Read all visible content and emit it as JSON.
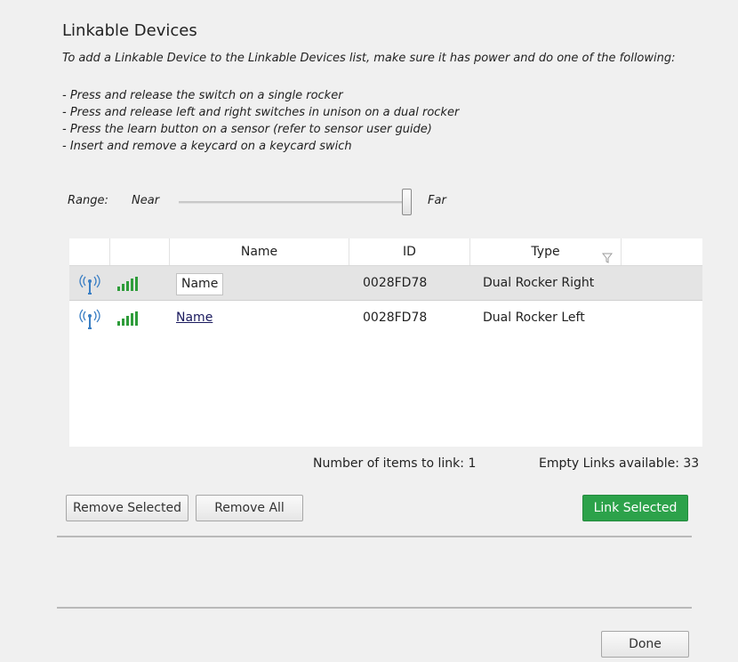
{
  "title": "Linkable Devices",
  "intro": "To add a Linkable Device to the Linkable Devices list, make sure it has power and do one of the following:",
  "instructions": [
    "- Press and release the switch on a single rocker",
    "- Press and release left and right switches in unison on a dual rocker",
    "- Press the learn button on a sensor (refer to sensor user guide)",
    "- Insert and remove a keycard on a keycard swich"
  ],
  "range": {
    "label": "Range:",
    "min_label": "Near",
    "max_label": "Far",
    "value_fraction": 0.98
  },
  "table": {
    "columns": [
      "Name",
      "ID",
      "Type"
    ],
    "rows": [
      {
        "name": "Name",
        "id": "0028FD78",
        "type": "Dual Rocker Right",
        "selected": true,
        "editing": true
      },
      {
        "name": "Name",
        "id": "0028FD78",
        "type": "Dual Rocker Left",
        "selected": false,
        "editing": false
      }
    ]
  },
  "status": {
    "items_to_link": "Number of items to link: 1",
    "empty_links": "Empty Links available: 33"
  },
  "buttons": {
    "remove_selected": "Remove Selected",
    "remove_all": "Remove All",
    "link_selected": "Link Selected",
    "done": "Done"
  },
  "colors": {
    "accent_green": "#2ca24a",
    "signal_green": "#2e9c3a",
    "antenna_blue": "#3b7fc4"
  }
}
